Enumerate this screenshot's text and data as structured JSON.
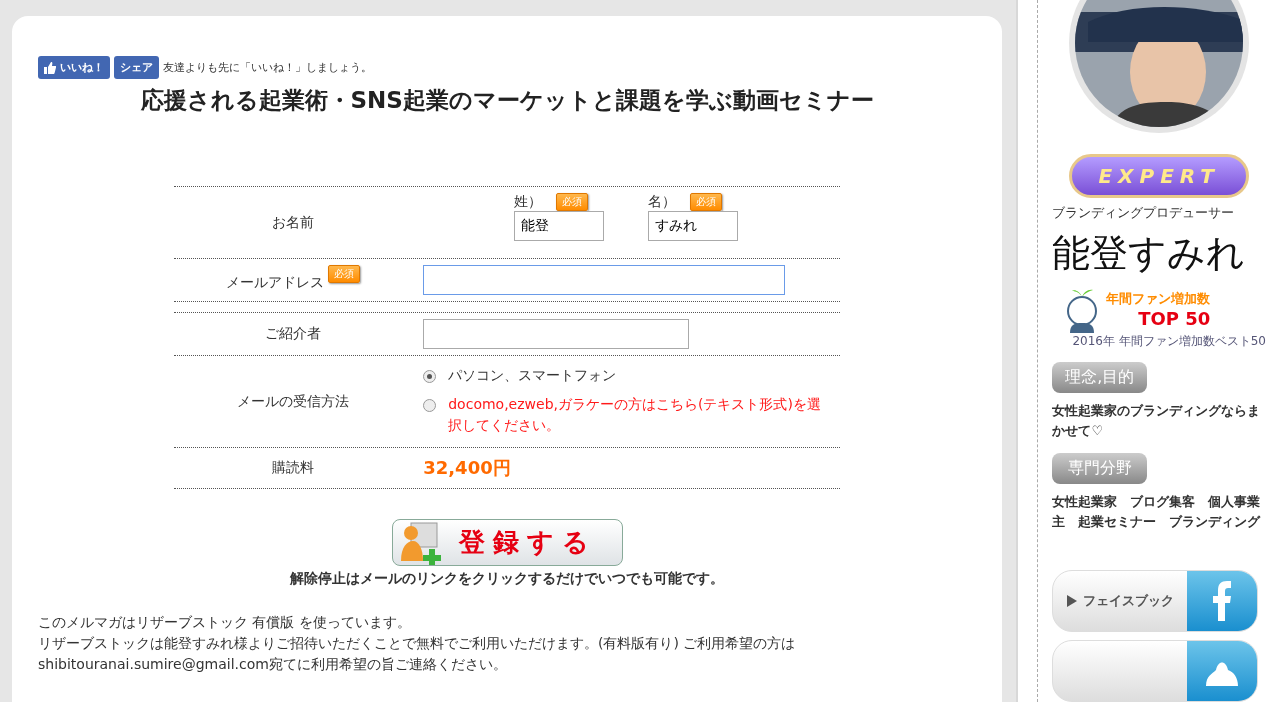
{
  "social": {
    "like": "いいね！",
    "share": "シェア",
    "prompt": "友達よりも先に「いいね！」しましょう。"
  },
  "title": "応援される起業術・SNS起業のマーケットと課題を学ぶ動画セミナー",
  "form": {
    "rows": [
      {
        "kind": "name",
        "label": "お名前",
        "last_label": "姓）",
        "last_value": "能登",
        "last_badge": "必須",
        "first_label": "名）",
        "first_value": "すみれ",
        "first_badge": "必須"
      },
      {
        "kind": "email",
        "label": "メールアドレス",
        "badge": "必須",
        "value": "",
        "focused": true
      },
      {
        "kind": "spacer"
      },
      {
        "kind": "text",
        "label": "ご紹介者",
        "value": "",
        "focused": false
      },
      {
        "kind": "radio",
        "label": "メールの受信方法",
        "options": [
          {
            "label": "パソコン、スマートフォン",
            "selected": true,
            "color": "#333333"
          },
          {
            "label": "docomo,ezweb,ガラケーの方はこちら(テキスト形式)を選択してください。",
            "selected": false,
            "color": "#ff1a1a"
          }
        ]
      },
      {
        "kind": "price",
        "label": "購読料",
        "value": "32,400円"
      }
    ]
  },
  "register_button": "登録する",
  "unsubscribe_note": "解除停止はメールのリンクをクリックするだけでいつでも可能です。",
  "footer_lines": [
    "このメルマガはリザーブストック 有償版 を使っています。",
    "リザーブストックは能登すみれ様よりご招待いただくことで無料でご利用いただけます。(有料版有り) ご利用希望の方は",
    "shibitouranai.sumire@gmail.com宛てに利用希望の旨ご連絡ください。"
  ],
  "sidebar": {
    "expert_badge": {
      "text": "EXPERT"
    },
    "role": "ブランディングプロデューサー",
    "name": "能登すみれ",
    "award": {
      "title": "年間ファン増加数",
      "rank": "TOP 50",
      "caption": "2016年 年間ファン増加数ベスト50"
    },
    "sections": [
      {
        "heading": "理念,目的",
        "text": "女性起業家のブランディングならまかせて♡"
      },
      {
        "heading": "専門分野",
        "text": "女性起業家　ブログ集客　個人事業主　起業セミナー　ブランディング"
      }
    ],
    "link_buttons": [
      {
        "kind": "facebook",
        "label": "フェイスブック"
      },
      {
        "kind": "ameba"
      }
    ]
  }
}
